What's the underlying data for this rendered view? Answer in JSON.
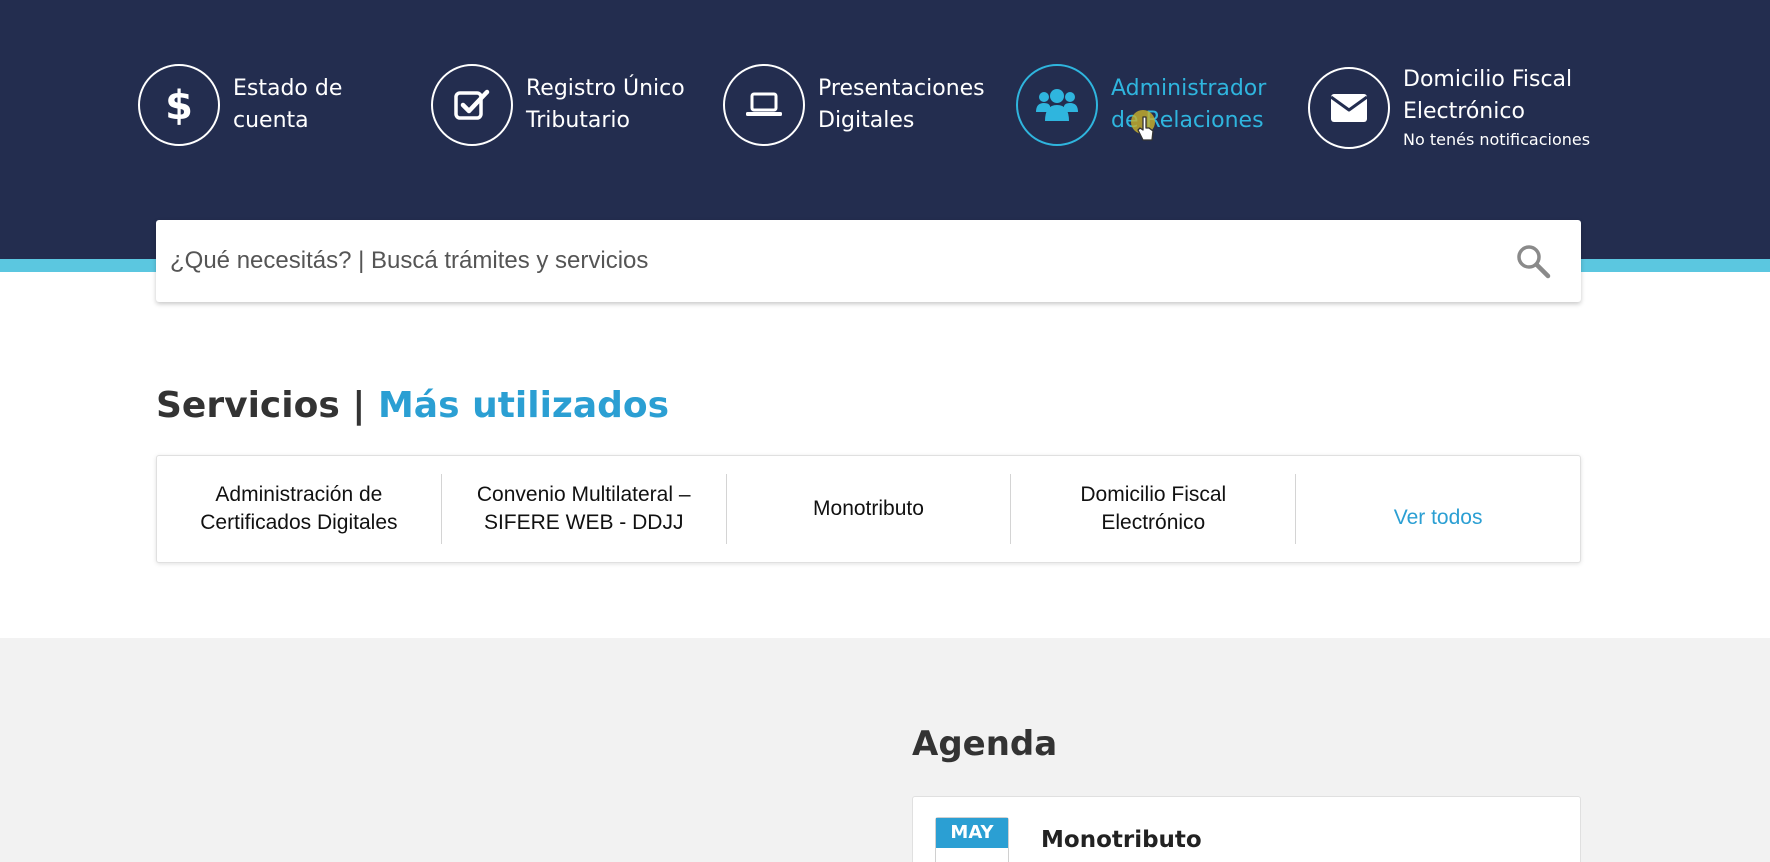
{
  "quick_access": [
    {
      "label_line1": "Estado de",
      "label_line2": "cuenta",
      "sub": "",
      "icon": "dollar-icon"
    },
    {
      "label_line1": "Registro Único",
      "label_line2": "Tributario",
      "sub": "",
      "icon": "checkbox-icon"
    },
    {
      "label_line1": "Presentaciones",
      "label_line2": "Digitales",
      "sub": "",
      "icon": "laptop-icon"
    },
    {
      "label_line1": "Administrador",
      "label_line2": "de Relaciones",
      "sub": "",
      "icon": "users-icon",
      "active": true
    },
    {
      "label_line1": "Domicilio Fiscal",
      "label_line2": "Electrónico",
      "sub": "No tenés notificaciones",
      "icon": "envelope-icon"
    }
  ],
  "search": {
    "placeholder": "¿Qué necesitás? | Buscá trámites y servicios",
    "icon": "search-icon"
  },
  "services": {
    "title": "Servicios |",
    "title_accent": "Más utilizados",
    "items": [
      {
        "line1": "Administración de",
        "line2": "Certificados Digitales"
      },
      {
        "line1": "Convenio Multilateral –",
        "line2": "SIFERE WEB - DDJJ"
      },
      {
        "line1": "Monotributo",
        "line2": ""
      },
      {
        "line1": "Domicilio Fiscal",
        "line2": "Electrónico"
      }
    ],
    "see_all": "Ver todos"
  },
  "agenda": {
    "title": "Agenda",
    "items": [
      {
        "month": "MAY",
        "title": "Monotributo"
      }
    ]
  },
  "colors": {
    "header_bg": "#232d4f",
    "accent_stripe": "#5bc7e0",
    "accent": "#2b9fd3",
    "active": "#2fb5de"
  }
}
